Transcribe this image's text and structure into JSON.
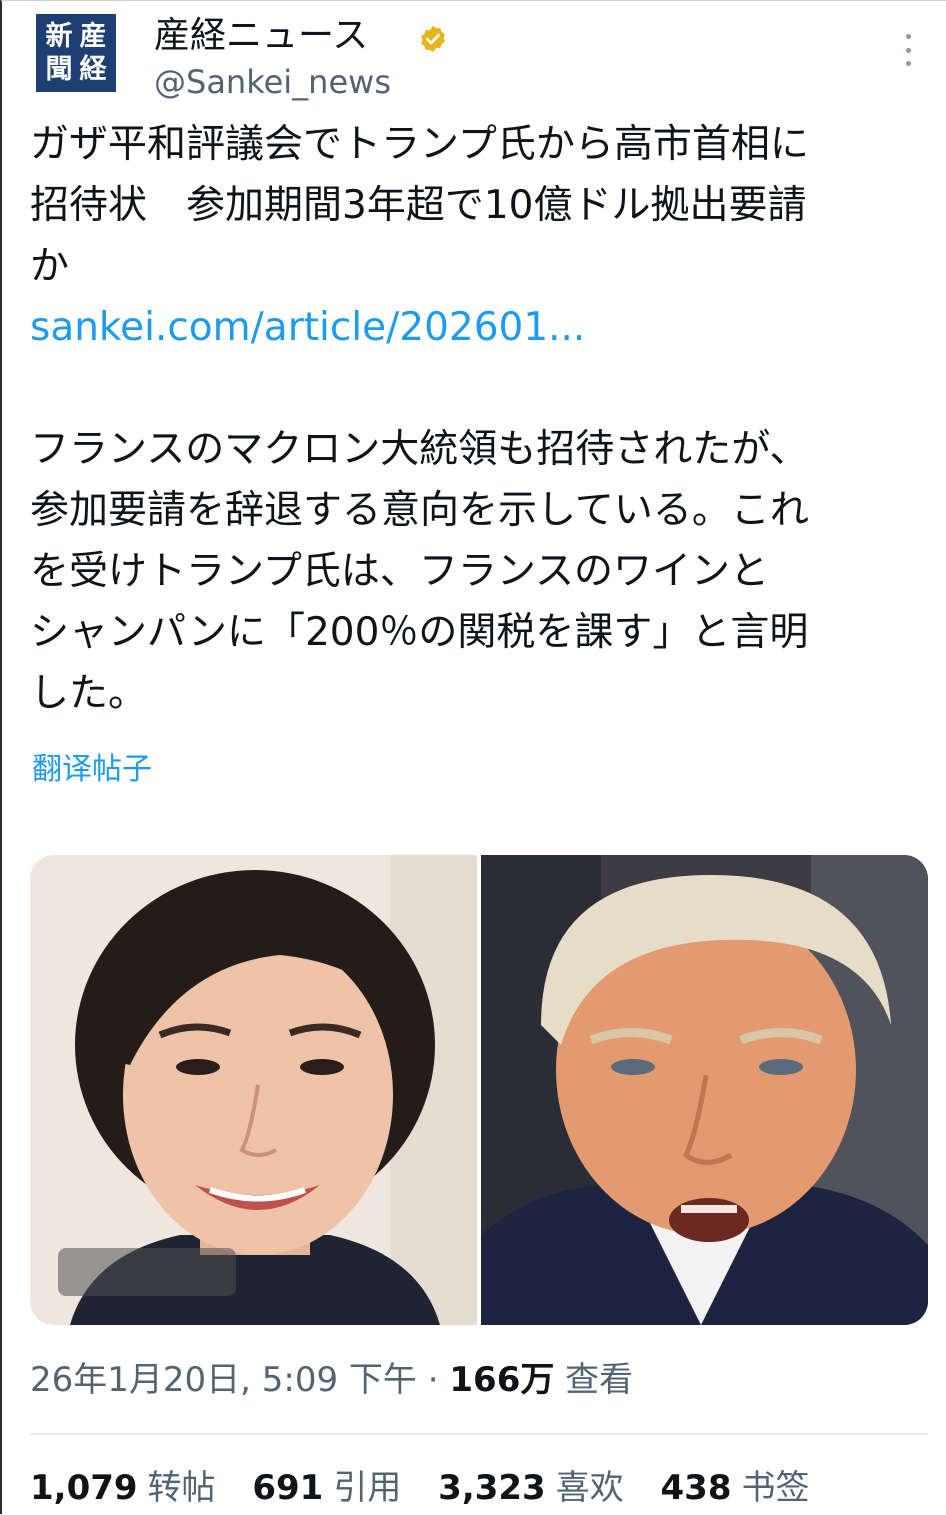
{
  "header": {
    "avatar_chars": [
      "新",
      "産",
      "聞",
      "経"
    ],
    "display_name": "産経ニュース",
    "handle": "@Sankei_news",
    "verified_color": "#e8b418"
  },
  "tweet": {
    "headline_lines": [
      "ガザ平和評議会でトランプ氏から高市首相に",
      "招待状　参加期間3年超で10億ドル拠出要請",
      "か"
    ],
    "link": "sankei.com/article/202601...",
    "body_lines": [
      "フランスのマクロン大統領も招待されたが、",
      "参加要請を辞退する意向を示している。これ",
      "を受けトランプ氏は、フランスのワインと",
      "シャンパンに「200％の関税を課す」と言明",
      "した。"
    ],
    "translate_label": "翻译帖子"
  },
  "media": {
    "left_photo": "woman-portrait",
    "right_photo": "man-portrait"
  },
  "meta": {
    "timestamp": "26年1月20日, 5:09 下午",
    "separator": " · ",
    "views_count": "166万",
    "views_label": " 查看"
  },
  "stats": [
    {
      "count": "1,079",
      "label": "转帖"
    },
    {
      "count": "691",
      "label": "引用"
    },
    {
      "count": "3,323",
      "label": "喜欢"
    },
    {
      "count": "438",
      "label": "书签"
    }
  ],
  "colors": {
    "link": "#1d9bf0",
    "secondary_text": "#536471",
    "primary_text": "#0f1419"
  }
}
